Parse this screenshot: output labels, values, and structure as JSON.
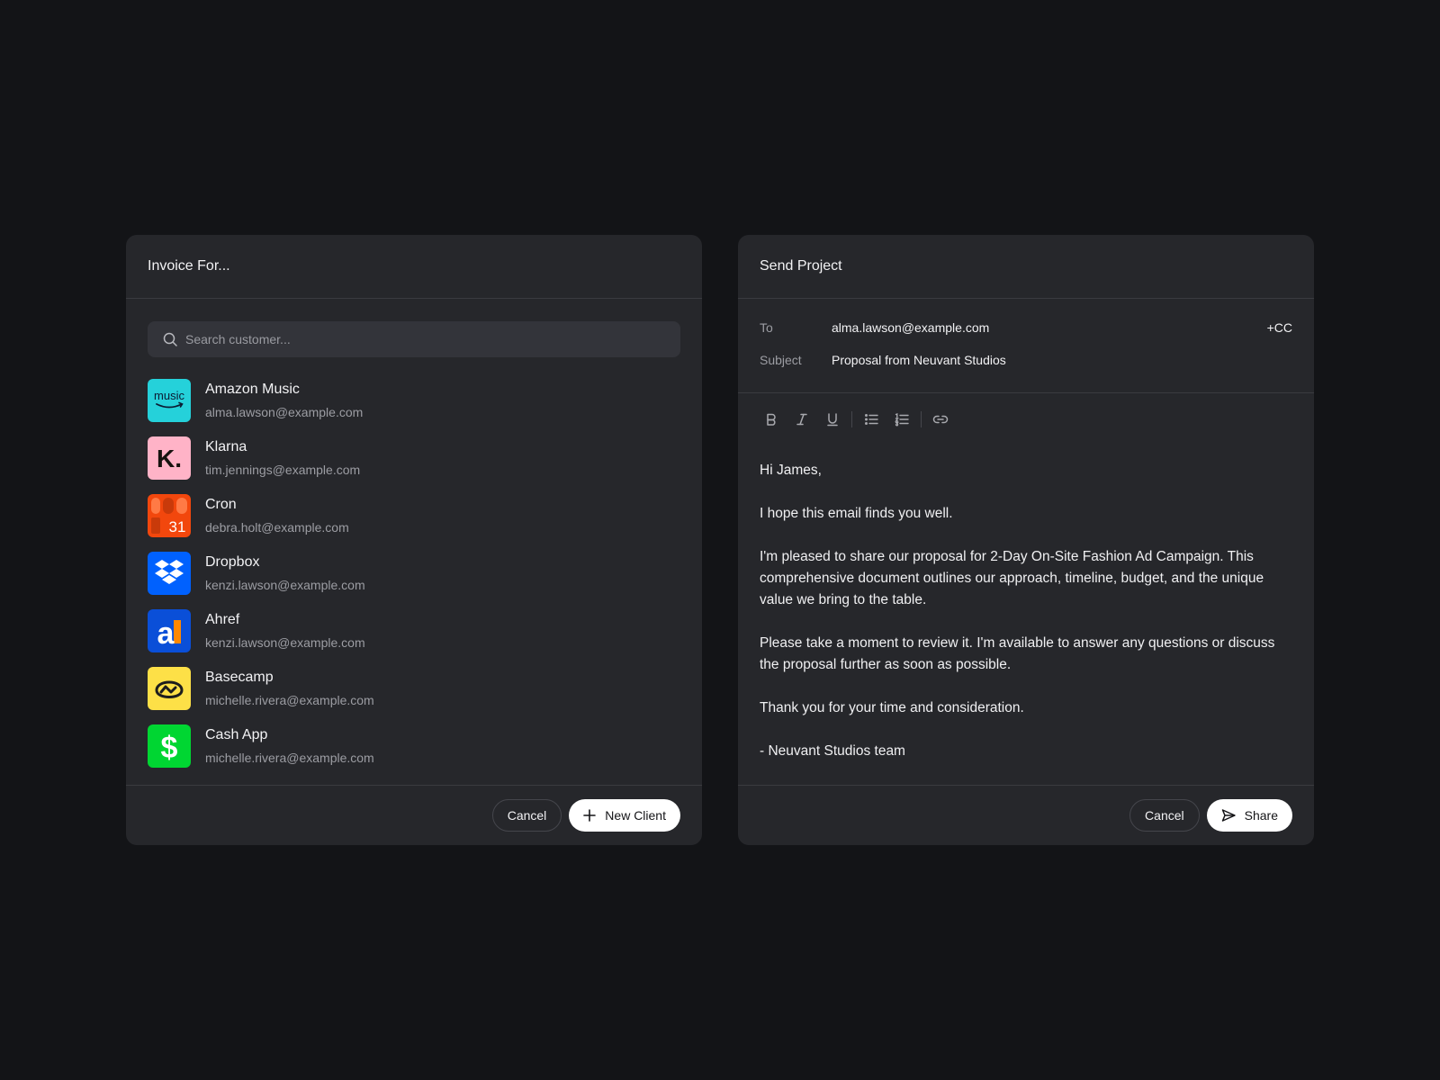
{
  "invoice_panel": {
    "title": "Invoice For...",
    "search": {
      "placeholder": "Search customer...",
      "value": ""
    },
    "clients": [
      {
        "name": "Amazon Music",
        "email": "alma.lawson@example.com",
        "icon": "amazon-music-logo",
        "color": "#25D1DA"
      },
      {
        "name": "Klarna",
        "email": "tim.jennings@example.com",
        "icon": "klarna-logo",
        "color": "#FFB3C7"
      },
      {
        "name": "Cron",
        "email": "debra.holt@example.com",
        "icon": "cron-logo",
        "color": "#F2470D"
      },
      {
        "name": "Dropbox",
        "email": "kenzi.lawson@example.com",
        "icon": "dropbox-logo",
        "color": "#0061FE"
      },
      {
        "name": "Ahref",
        "email": "kenzi.lawson@example.com",
        "icon": "ahrefs-logo",
        "color": "#0A4FD8"
      },
      {
        "name": "Basecamp",
        "email": "michelle.rivera@example.com",
        "icon": "basecamp-logo",
        "color": "#FDE047"
      },
      {
        "name": "Cash App",
        "email": "michelle.rivera@example.com",
        "icon": "cash-app-logo",
        "color": "#00D632"
      }
    ],
    "logo_text": {
      "amazon_music": "music",
      "klarna": "K.",
      "cron": "31",
      "ahrefs": "a",
      "cash_app": "$"
    },
    "cancel_label": "Cancel",
    "new_client_label": "New Client"
  },
  "send_panel": {
    "title": "Send Project",
    "to_label": "To",
    "to_value": "alma.lawson@example.com",
    "cc_label": "+CC",
    "subject_label": "Subject",
    "subject_value": "Proposal from Neuvant Studios",
    "toolbar": [
      "bold-icon",
      "italic-icon",
      "underline-icon",
      "bullet-list-icon",
      "numbered-list-icon",
      "link-icon"
    ],
    "body": {
      "greeting": "Hi James,",
      "p1": "I hope this email finds you well.",
      "p2": "I'm pleased to share our proposal for 2-Day On-Site Fashion Ad Campaign. This comprehensive document outlines our approach, timeline, budget, and the unique value we bring to the table.",
      "p3": "Please take a moment to review it. I'm available to answer any questions or discuss the proposal further as soon as possible.",
      "p4": "Thank you for your time and consideration.",
      "signature": "- Neuvant Studios team"
    },
    "cancel_label": "Cancel",
    "share_label": "Share"
  }
}
